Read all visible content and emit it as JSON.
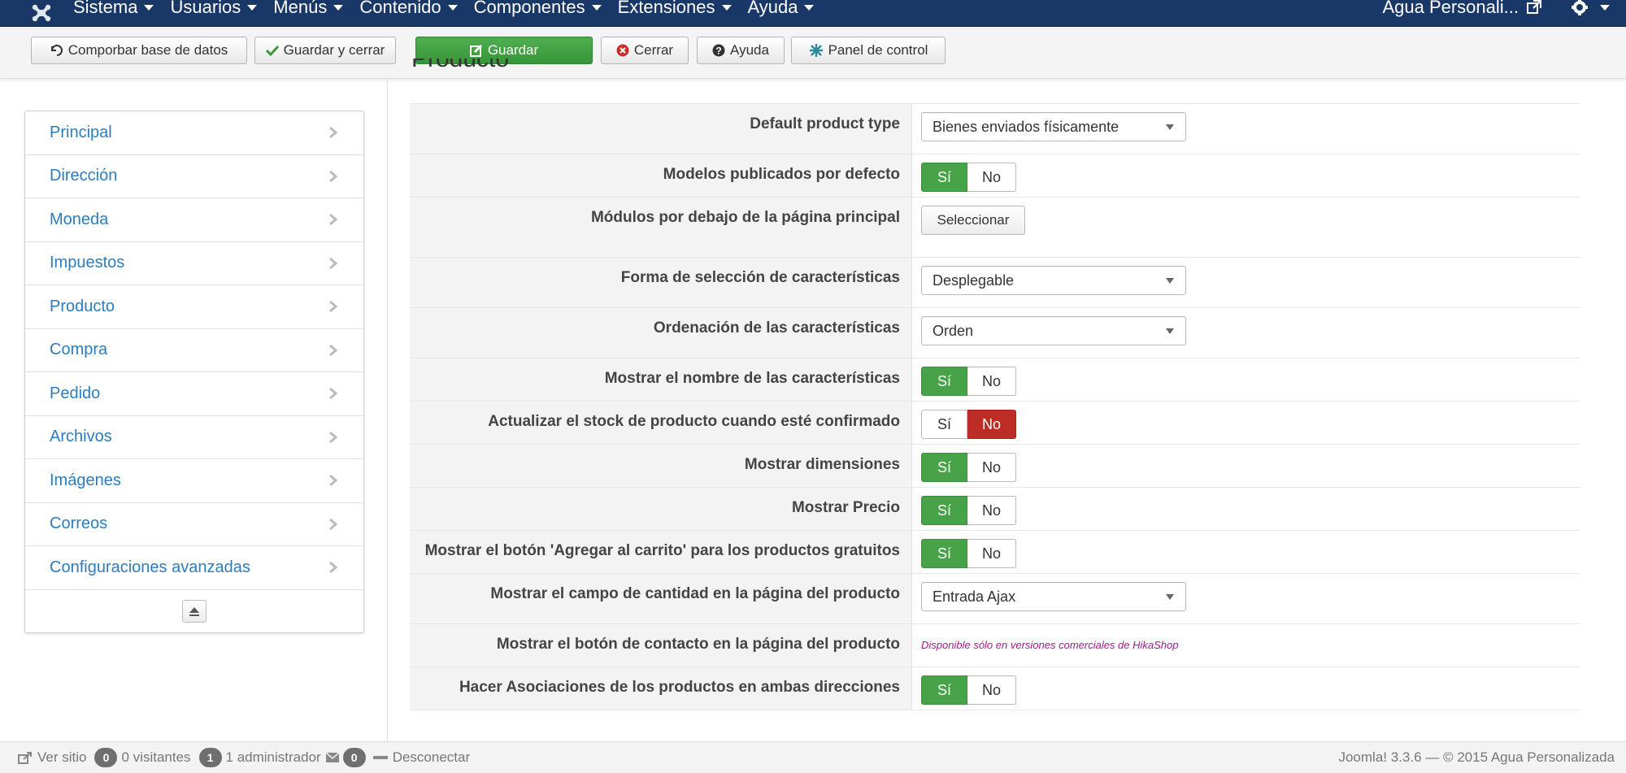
{
  "topbar": {
    "menu": [
      "Sistema",
      "Usuarios",
      "Menús",
      "Contenido",
      "Componentes",
      "Extensiones",
      "Ayuda"
    ],
    "user": "Agua Personali..."
  },
  "toolbar": {
    "check_db": "Comporbar base de datos",
    "save_close": "Guardar y cerrar",
    "save": "Guardar",
    "close": "Cerrar",
    "help": "Ayuda",
    "control_panel": "Panel de control"
  },
  "sidebar": {
    "items": [
      "Principal",
      "Dirección",
      "Moneda",
      "Impuestos",
      "Producto",
      "Compra",
      "Pedido",
      "Archivos",
      "Imágenes",
      "Correos",
      "Configuraciones avanzadas"
    ]
  },
  "section": {
    "title": "Producto"
  },
  "form": {
    "default_product_type": {
      "label": "Default product type",
      "value": "Bienes enviados físicamente"
    },
    "models_published": {
      "label": "Modelos publicados por defecto",
      "yes": "Sí",
      "no": "No",
      "selected": "yes"
    },
    "modules_below": {
      "label": "Módulos por debajo de la página principal",
      "button": "Seleccionar"
    },
    "characteristics_selection": {
      "label": "Forma de selección de características",
      "value": "Desplegable"
    },
    "characteristics_order": {
      "label": "Ordenación de las características",
      "value": "Orden"
    },
    "show_characteristics_name": {
      "label": "Mostrar el nombre de las características",
      "yes": "Sí",
      "no": "No",
      "selected": "yes"
    },
    "update_stock": {
      "label": "Actualizar el stock de producto cuando esté confirmado",
      "yes": "Sí",
      "no": "No",
      "selected": "no"
    },
    "show_dimensions": {
      "label": "Mostrar dimensiones",
      "yes": "Sí",
      "no": "No",
      "selected": "yes"
    },
    "show_price": {
      "label": "Mostrar Precio",
      "yes": "Sí",
      "no": "No",
      "selected": "yes"
    },
    "add_to_cart_free": {
      "label": "Mostrar el botón 'Agregar al carrito' para los productos gratuitos",
      "yes": "Sí",
      "no": "No",
      "selected": "yes"
    },
    "quantity_field": {
      "label": "Mostrar el campo de cantidad en la página del producto",
      "value": "Entrada Ajax"
    },
    "contact_button": {
      "label": "Mostrar el botón de contacto en la página del producto",
      "note": "Disponible sólo en versiones comerciales de HikaShop"
    },
    "associations": {
      "label": "Hacer Asociaciones de los productos en ambas direcciones",
      "yes": "Sí",
      "no": "No",
      "selected": "yes"
    }
  },
  "footer": {
    "view_site": "Ver sitio",
    "visitors_count": "0",
    "visitors_label": "0 visitantes",
    "admins_count": "1",
    "admins_label": "1 administrador",
    "messages_count": "0",
    "logout": "Desconectar",
    "version": "Joomla! 3.3.6 — © 2015 Agua Personalizada"
  },
  "colors": {
    "navbar": "#1a3867",
    "green": "#48a348",
    "red": "#bd2c25",
    "link": "#2a7dc0"
  }
}
